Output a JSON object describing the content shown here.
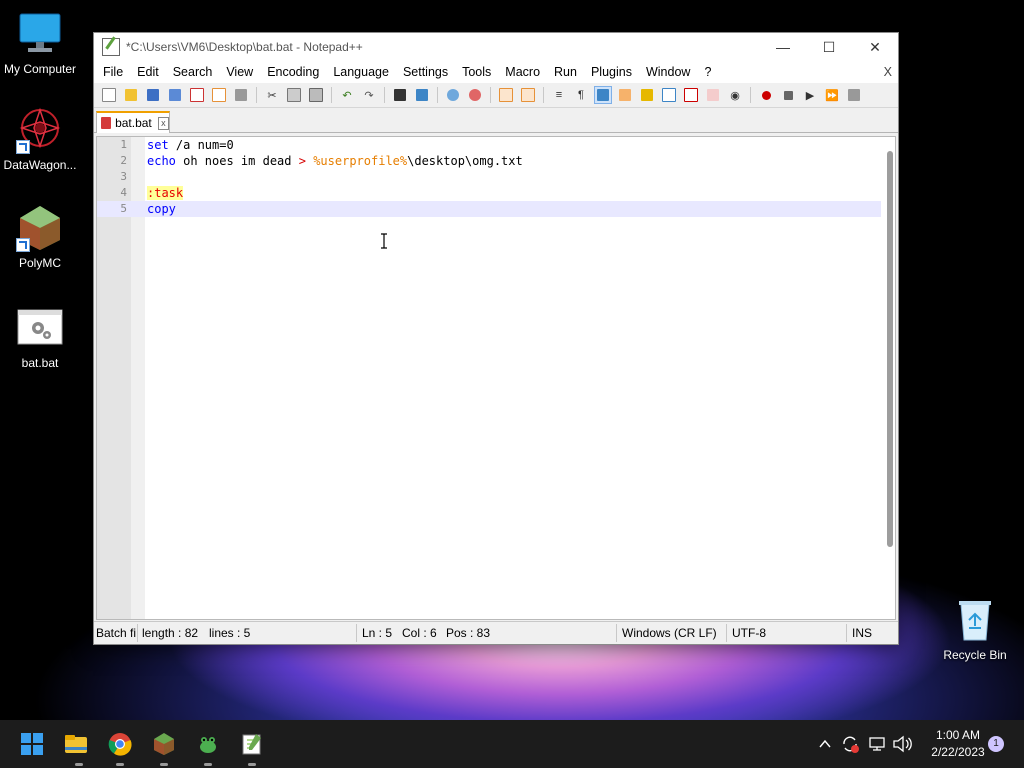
{
  "desktop": {
    "icons": [
      {
        "label": "My Computer"
      },
      {
        "label": "DataWagon..."
      },
      {
        "label": "PolyMC"
      },
      {
        "label": "bat.bat"
      },
      {
        "label": "Recycle Bin"
      }
    ]
  },
  "window": {
    "title": "*C:\\Users\\VM6\\Desktop\\bat.bat - Notepad++",
    "buttons": {
      "minimize": "—",
      "maximize": "☐",
      "close": "✕"
    },
    "menu": [
      "File",
      "Edit",
      "Search",
      "View",
      "Encoding",
      "Language",
      "Settings",
      "Tools",
      "Macro",
      "Run",
      "Plugins",
      "Window",
      "?"
    ],
    "menu_close": "X"
  },
  "tab": {
    "label": "bat.bat",
    "close": "x"
  },
  "editor": {
    "lines": [
      {
        "num": "1",
        "kw": "set",
        "rest": " /a num=0"
      },
      {
        "num": "2",
        "kw": "echo",
        "rest": " oh noes im dead ",
        "op": ">",
        "var": " %userprofile%",
        "tail": "\\desktop\\omg.txt"
      },
      {
        "num": "3"
      },
      {
        "num": "4",
        "label": ":task"
      },
      {
        "num": "5",
        "kw": "copy"
      }
    ]
  },
  "statusbar": {
    "lang": "Batch fi",
    "length": "length : 82",
    "lines": "lines : 5",
    "ln": "Ln : 5",
    "col": "Col : 6",
    "pos": "Pos : 83",
    "eol": "Windows (CR LF)",
    "encoding": "UTF-8",
    "mode": "INS"
  },
  "taskbar": {
    "time": "1:00 AM",
    "date": "2/22/2023",
    "notifications": "1"
  }
}
